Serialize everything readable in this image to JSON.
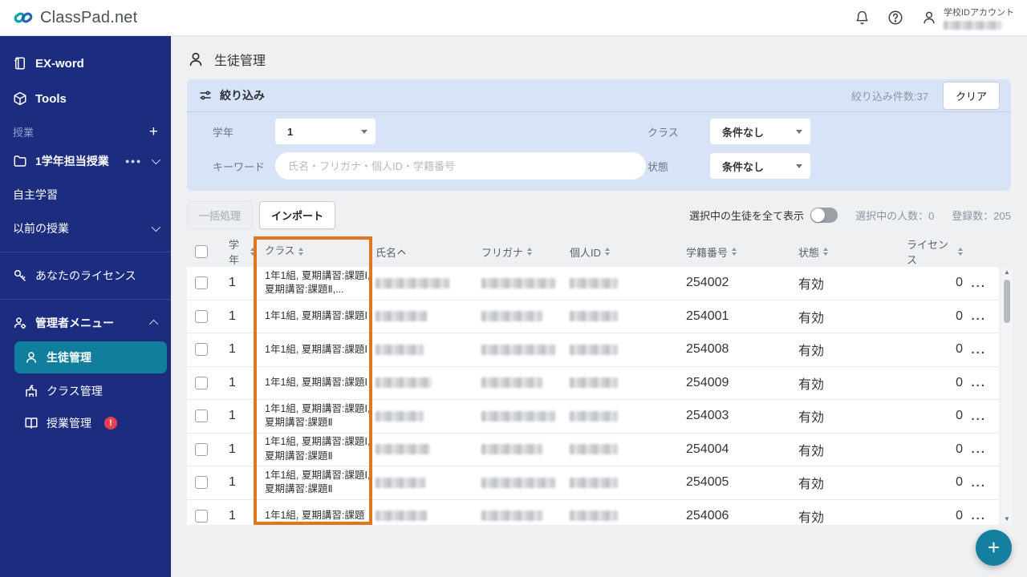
{
  "colors": {
    "sidebar": "#1c2c7e",
    "selected_teal": "#117e9d",
    "fab_teal": "#147f9e",
    "highlight_orange": "#e0771c",
    "filter_bg": "#d9e3f7",
    "badge_red": "#e9404d"
  },
  "header": {
    "logo_text": "ClassPad.net",
    "account_label": "学校IDアカウント"
  },
  "sidebar": {
    "ex_word": "EX-word",
    "tools": "Tools",
    "section_lessons": "授業",
    "lesson_folder": "1学年担当授業",
    "self_study": "自主学習",
    "previous_lessons": "以前の授業",
    "your_license": "あなたのライセンス",
    "admin_menu": "管理者メニュー",
    "student_mgmt": "生徒管理",
    "class_mgmt": "クラス管理",
    "lesson_mgmt": "授業管理",
    "alert_mark": "!"
  },
  "page": {
    "title": "生徒管理"
  },
  "filter": {
    "title": "絞り込み",
    "count_text": "絞り込み件数:37",
    "clear_label": "クリア",
    "grade_label": "学年",
    "grade_value": "1",
    "class_label": "クラス",
    "class_value": "条件なし",
    "keyword_label": "キーワード",
    "keyword_placeholder": "氏名・フリガナ・個人ID・学籍番号",
    "status_label": "状態",
    "status_value": "条件なし"
  },
  "toolbar": {
    "bulk_label": "一括処理",
    "import_label": "インポート",
    "show_selected_label": "選択中の生徒を全て表示",
    "selected_count": "選択中の人数：0",
    "registered_count": "登録数：205"
  },
  "table": {
    "headers": [
      {
        "label": "学年"
      },
      {
        "label": "クラス"
      },
      {
        "label": "氏名"
      },
      {
        "label": "フリガナ"
      },
      {
        "label": "個人ID"
      },
      {
        "label": "学籍番号"
      },
      {
        "label": "状態"
      },
      {
        "label": "ライセンス"
      }
    ],
    "rows": [
      {
        "grade": "1",
        "class": "1年1組, 夏期講習:課題Ⅰ, 夏期講習:課題Ⅱ,...",
        "student_no": "254002",
        "status": "有効",
        "license": "0",
        "menu": "..."
      },
      {
        "grade": "1",
        "class": "1年1組, 夏期講習:課題Ⅰ",
        "student_no": "254001",
        "status": "有効",
        "license": "0",
        "menu": "..."
      },
      {
        "grade": "1",
        "class": "1年1組, 夏期講習:課題Ⅰ",
        "student_no": "254008",
        "status": "有効",
        "license": "0",
        "menu": "..."
      },
      {
        "grade": "1",
        "class": "1年1組, 夏期講習:課題Ⅰ",
        "student_no": "254009",
        "status": "有効",
        "license": "0",
        "menu": "..."
      },
      {
        "grade": "1",
        "class": "1年1組, 夏期講習:課題Ⅰ, 夏期講習:課題Ⅱ",
        "student_no": "254003",
        "status": "有効",
        "license": "0",
        "menu": "..."
      },
      {
        "grade": "1",
        "class": "1年1組, 夏期講習:課題Ⅰ, 夏期講習:課題Ⅱ",
        "student_no": "254004",
        "status": "有効",
        "license": "0",
        "menu": "..."
      },
      {
        "grade": "1",
        "class": "1年1組, 夏期講習:課題Ⅰ, 夏期講習:課題Ⅱ",
        "student_no": "254005",
        "status": "有効",
        "license": "0",
        "menu": "..."
      },
      {
        "grade": "1",
        "class": "1年1組, 夏期講習:課題",
        "student_no": "254006",
        "status": "有効",
        "license": "0",
        "menu": "..."
      }
    ]
  },
  "fab": {
    "label": "+"
  }
}
